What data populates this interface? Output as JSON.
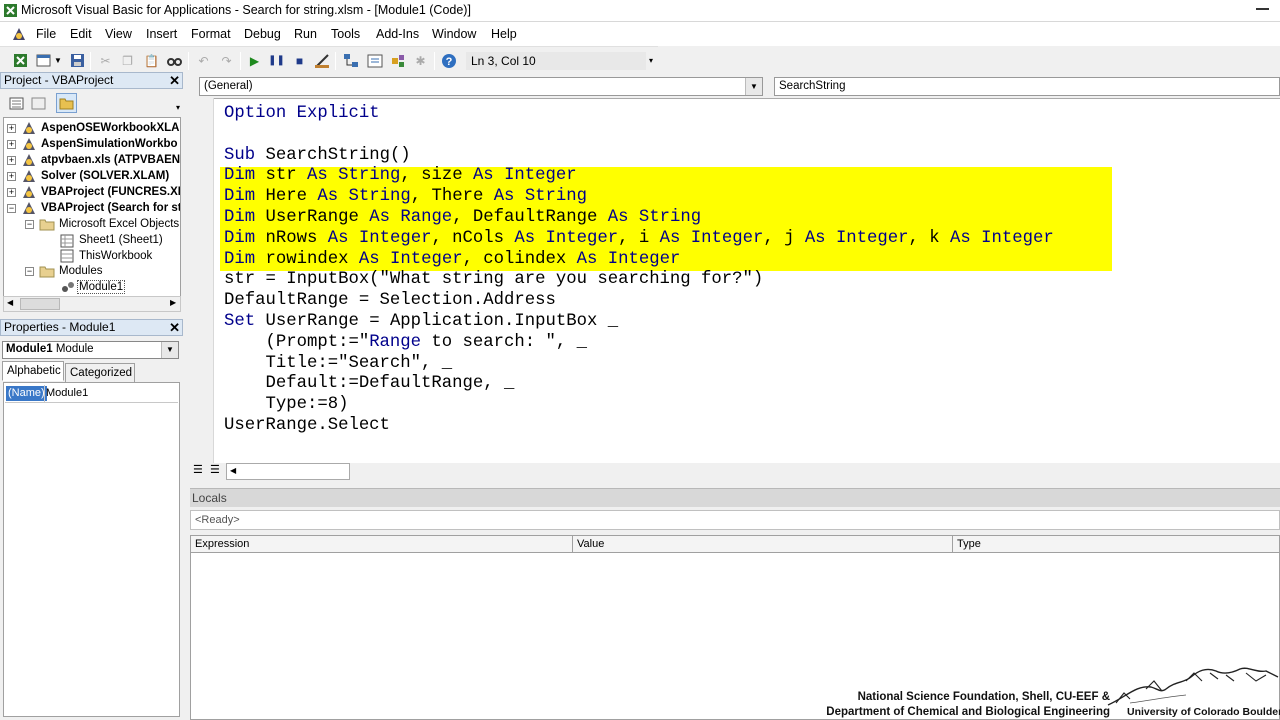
{
  "window": {
    "title": "Microsoft Visual Basic for Applications - Search for string.xlsm - [Module1 (Code)]"
  },
  "menu": [
    "File",
    "Edit",
    "View",
    "Insert",
    "Format",
    "Debug",
    "Run",
    "Tools",
    "Add-Ins",
    "Window",
    "Help"
  ],
  "toolbar": {
    "position": "Ln 3, Col 10"
  },
  "project": {
    "title": "Project - VBAProject",
    "items": [
      "AspenOSEWorkbookXLA (",
      "AspenSimulationWorkbo",
      "atpvbaen.xls (ATPVBAEN.",
      "Solver (SOLVER.XLAM)",
      "VBAProject (FUNCRES.XLA",
      "VBAProject (Search for st",
      "Microsoft Excel Objects",
      "Sheet1 (Sheet1)",
      "ThisWorkbook",
      "Modules",
      "Module1"
    ]
  },
  "properties": {
    "title": "Properties - Module1",
    "combo_name": "Module1",
    "combo_type": "Module",
    "tabs": [
      "Alphabetic",
      "Categorized"
    ],
    "row_key": "(Name)",
    "row_value": "Module1"
  },
  "code": {
    "object_combo": "(General)",
    "proc_combo": "SearchString",
    "lines": [
      {
        "kw": "Option Explicit",
        "rest": ""
      },
      {
        "kw": "",
        "rest": ""
      },
      {
        "kw": "Sub",
        "rest": " SearchString()"
      },
      {
        "kw": "",
        "rest": "Dim str As String, size As Integer"
      },
      {
        "kw": "",
        "rest": "Dim Here As String, There As String"
      },
      {
        "kw": "",
        "rest": "Dim UserRange As Range, DefaultRange As String"
      },
      {
        "kw": "",
        "rest": "Dim nRows As Integer, nCols As Integer, i As Integer, j As Integer, k As Integer"
      },
      {
        "kw": "",
        "rest": "Dim rowindex As Integer, colindex As Integer"
      },
      {
        "kw": "",
        "rest": "str = InputBox(\"What string are you searching for?\")"
      },
      {
        "kw": "",
        "rest": "DefaultRange = Selection.Address"
      },
      {
        "kw": "Set",
        "rest": " UserRange = Application.InputBox _"
      },
      {
        "kw": "",
        "rest": "    (Prompt:=\"Range to search: \", _"
      },
      {
        "kw": "",
        "rest": "    Title:=\"Search\", _"
      },
      {
        "kw": "",
        "rest": "    Default:=DefaultRange, _"
      },
      {
        "kw": "",
        "rest": "    Type:=8)"
      },
      {
        "kw": "",
        "rest": "UserRange.Select"
      }
    ]
  },
  "locals": {
    "title": "Locals",
    "status": "<Ready>",
    "columns": [
      "Expression",
      "Value",
      "Type"
    ]
  },
  "credit": {
    "line1": "National Science Foundation, Shell, CU-EEF &",
    "line2": "Department of Chemical and Biological Engineering",
    "university": "University of Colorado Boulder"
  },
  "colors": {
    "highlight": "#ffff00",
    "keyword": "#00008b"
  }
}
